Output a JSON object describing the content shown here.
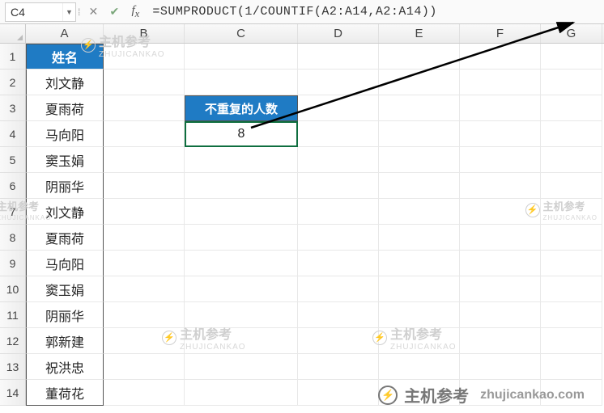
{
  "name_box": "C4",
  "formula": "=SUMPRODUCT(1/COUNTIF(A2:A14,A2:A14))",
  "columns": [
    "A",
    "B",
    "C",
    "D",
    "E",
    "F",
    "G"
  ],
  "rows": [
    "1",
    "2",
    "3",
    "4",
    "5",
    "6",
    "7",
    "8",
    "9",
    "10",
    "11",
    "12",
    "13",
    "14"
  ],
  "header_A1": "姓名",
  "col_a": [
    "刘文静",
    "夏雨荷",
    "马向阳",
    "窦玉娟",
    "阴丽华",
    "刘文静",
    "夏雨荷",
    "马向阳",
    "窦玉娟",
    "阴丽华",
    "郭新建",
    "祝洪忠",
    "董荷花"
  ],
  "label_C3": "不重复的人数",
  "value_C4": "8",
  "watermark": {
    "text": "主机参考",
    "sub": "ZHUJICANKAO",
    "url": "zhujicankao.com"
  },
  "chart_data": {
    "type": "table",
    "title": "不重复的人数",
    "columns": [
      "姓名"
    ],
    "rows": [
      [
        "刘文静"
      ],
      [
        "夏雨荷"
      ],
      [
        "马向阳"
      ],
      [
        "窦玉娟"
      ],
      [
        "阴丽华"
      ],
      [
        "刘文静"
      ],
      [
        "夏雨荷"
      ],
      [
        "马向阳"
      ],
      [
        "窦玉娟"
      ],
      [
        "阴丽华"
      ],
      [
        "郭新建"
      ],
      [
        "祝洪忠"
      ],
      [
        "董荷花"
      ]
    ],
    "computed": {
      "label": "不重复的人数",
      "value": 8,
      "formula": "=SUMPRODUCT(1/COUNTIF(A2:A14,A2:A14))"
    }
  }
}
